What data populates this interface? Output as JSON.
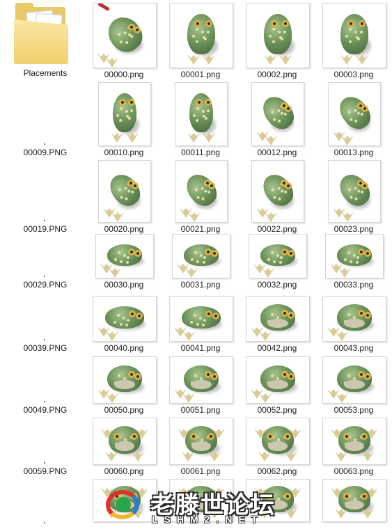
{
  "explorer": {
    "folder": {
      "label": "Placements",
      "icon": "folder-icon"
    },
    "rows": [
      {
        "row_label": "",
        "items": [
          "00000.png",
          "00001.png",
          "00002.png",
          "00003.png"
        ]
      },
      {
        "row_label": "00009.PNG",
        "items": [
          "00010.png",
          "00011.png",
          "00012.png",
          "00013.png"
        ]
      },
      {
        "row_label": "00019.PNG",
        "items": [
          "00020.png",
          "00021.png",
          "00022.png",
          "00023.png"
        ]
      },
      {
        "row_label": "00029.PNG",
        "items": [
          "00030.png",
          "00031.png",
          "00032.png",
          "00033.png"
        ]
      },
      {
        "row_label": "00039.PNG",
        "items": [
          "00040.png",
          "00041.png",
          "00042.png",
          "00043.png"
        ]
      },
      {
        "row_label": "00049.PNG",
        "items": [
          "00050.png",
          "00051.png",
          "00052.png",
          "00053.png"
        ]
      },
      {
        "row_label": "00059.PNG",
        "items": [
          "00060.png",
          "00061.png",
          "00062.png",
          "00063.png"
        ]
      },
      {
        "row_label": "",
        "items": [
          "",
          "",
          "",
          ""
        ]
      }
    ],
    "thumbnail_icon": "frog-sprite-thumbnail"
  },
  "watermark": {
    "text": "老滕世论坛",
    "url": "LSHM2.NET",
    "colors": [
      "#e0302a",
      "#f2b62b",
      "#2a7fd4",
      "#2aa44a"
    ]
  }
}
